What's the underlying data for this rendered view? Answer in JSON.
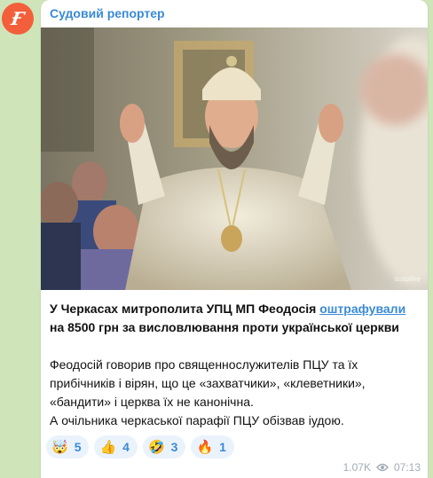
{
  "channel": {
    "name": "Судовий репортер",
    "avatar_glyph": "Ғ"
  },
  "photo": {
    "watermark": "suspilne"
  },
  "message": {
    "headline_before_link": "У Черкасах митрополита УПЦ МП Феодосія ",
    "headline_link": "оштрафували",
    "headline_after_link": " на 8500 грн за висловлювання проти української церкви",
    "body_line1": "Феодосій говорив про священнослужителів ПЦУ та їх прибічників і вірян, що це «захватчики», «клеветники», «бандити» і церква їх не канонічна.",
    "body_line2": "А очільника черкаської парафії ПЦУ обізвав іудою."
  },
  "reactions": [
    {
      "emoji": "🤯",
      "count": "5"
    },
    {
      "emoji": "👍",
      "count": "4"
    },
    {
      "emoji": "🤣",
      "count": "3"
    },
    {
      "emoji": "🔥",
      "count": "1"
    }
  ],
  "meta": {
    "views": "1.07K",
    "time": "07:13"
  },
  "colors": {
    "accent": "#3a8ad6",
    "background": "#cfe4b9",
    "avatar": "#f25f3a"
  }
}
